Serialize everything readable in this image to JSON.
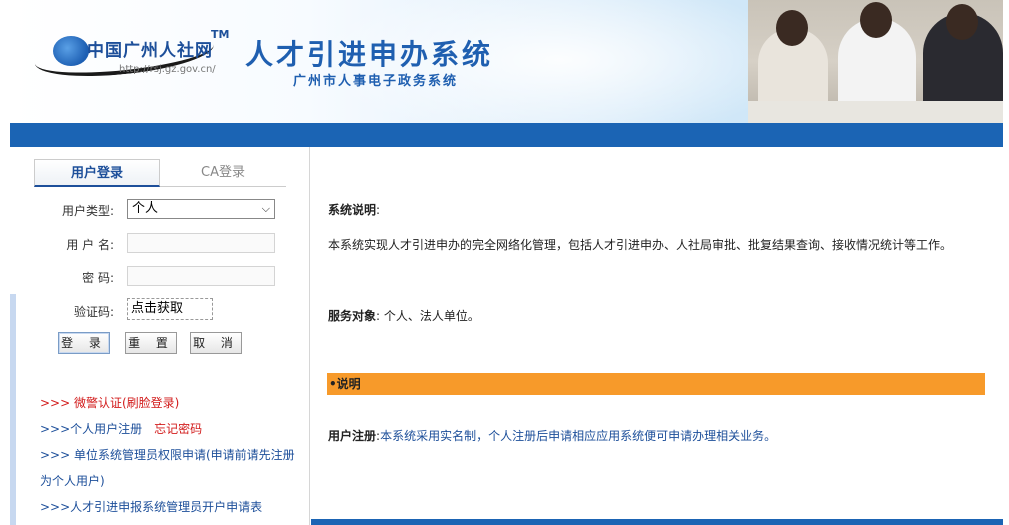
{
  "header": {
    "logo_text": "中国广州人社网",
    "logo_tm": "TM",
    "logo_url": "http://rsj.gz.gov.cn/",
    "title": "人才引进申办系统",
    "subtitle": "广州市人事电子政务系统"
  },
  "login": {
    "tabs": [
      "用户登录",
      "CA登录"
    ],
    "user_type_label": "用户类型:",
    "user_type_value": "个人",
    "username_label": "用 户 名:",
    "password_label": "密  码:",
    "captcha_label": "验证码:",
    "captcha_value": "点击获取",
    "login_button": "登 录",
    "reset_button": "重 置",
    "cancel_button": "取 消"
  },
  "links": {
    "police_auth": ">>> 微警认证(刷脸登录)",
    "personal_register": ">>>个人用户注册",
    "forgot_password": "忘记密码",
    "unit_admin_apply_1": ">>> 单位系统管理员权限申请(申请前请先注册",
    "unit_admin_apply_2": "为个人用户)",
    "talent_admin_form": ">>>人才引进申报系统管理员开户申请表"
  },
  "content": {
    "system_desc_title": "系统说明",
    "system_desc_colon": ":",
    "system_desc_text": "本系统实现人才引进申办的完全网络化管理，包括人才引进申办、人社局审批、批复结果查询、接收情况统计等工作。",
    "service_target_title": "服务对象",
    "service_target_text": ": 个人、法人单位。",
    "note_bar": "•说明",
    "user_register_title": "用户注册",
    "user_register_colon": ":",
    "user_register_text": "本系统采用实名制，个人注册后申请相应应用系统便可申请办理相关业务。"
  },
  "colors": {
    "brand_blue": "#1b64b4",
    "note_orange": "#f79a2a",
    "link_red": "#d21b1b",
    "link_blue": "#1d4f9a"
  }
}
